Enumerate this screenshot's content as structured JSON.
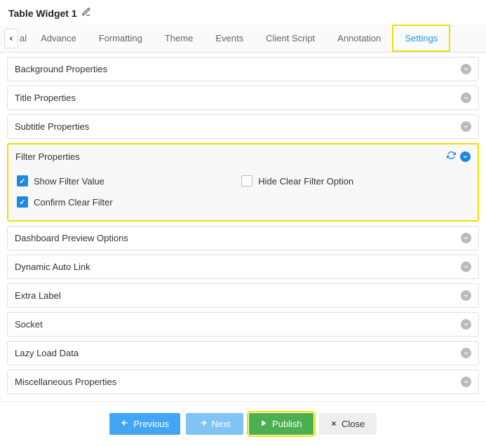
{
  "header": {
    "title": "Table Widget 1"
  },
  "tabs": {
    "partial": "al",
    "items": [
      "Advance",
      "Formatting",
      "Theme",
      "Events",
      "Client Script",
      "Annotation",
      "Settings"
    ],
    "active": "Settings"
  },
  "sections": {
    "background": {
      "title": "Background Properties"
    },
    "title": {
      "title": "Title Properties"
    },
    "subtitle": {
      "title": "Subtitle Properties"
    },
    "filter": {
      "title": "Filter Properties",
      "show_filter_value": {
        "label": "Show Filter Value",
        "checked": true
      },
      "hide_clear_filter": {
        "label": "Hide Clear Filter Option",
        "checked": false
      },
      "confirm_clear_filter": {
        "label": "Confirm Clear Filter",
        "checked": true
      }
    },
    "dashboard_preview": {
      "title": "Dashboard Preview Options"
    },
    "dynamic_auto_link": {
      "title": "Dynamic Auto Link"
    },
    "extra_label": {
      "title": "Extra Label"
    },
    "socket": {
      "title": "Socket"
    },
    "lazy_load": {
      "title": "Lazy Load Data"
    },
    "misc": {
      "title": "Miscellaneous Properties"
    }
  },
  "footer": {
    "previous": "Previous",
    "next": "Next",
    "publish": "Publish",
    "close": "Close"
  }
}
